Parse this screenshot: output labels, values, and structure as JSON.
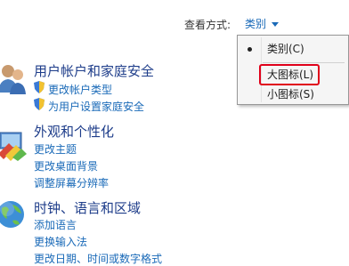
{
  "viewby": {
    "label": "查看方式:",
    "value": "类别"
  },
  "menu": {
    "items": [
      {
        "label": "类别(C)",
        "checked": true
      },
      {
        "label": "大图标(L)",
        "highlight": true
      },
      {
        "label": "小图标(S)"
      }
    ]
  },
  "categories": [
    {
      "title": "用户帐户和家庭安全",
      "icon": "users-icon",
      "links": [
        "更改帐户类型",
        "为用户设置家庭安全"
      ]
    },
    {
      "title": "外观和个性化",
      "icon": "appearance-icon",
      "links": [
        "更改主题",
        "更改桌面背景",
        "调整屏幕分辨率"
      ]
    },
    {
      "title": "时钟、语言和区域",
      "icon": "clock-globe-icon",
      "links": [
        "添加语言",
        "更换输入法",
        "更改日期、时间或数字格式"
      ]
    }
  ],
  "colors": {
    "link": "#1a6ab8",
    "title": "#1e3d8a",
    "highlight_box": "#e0001a"
  }
}
